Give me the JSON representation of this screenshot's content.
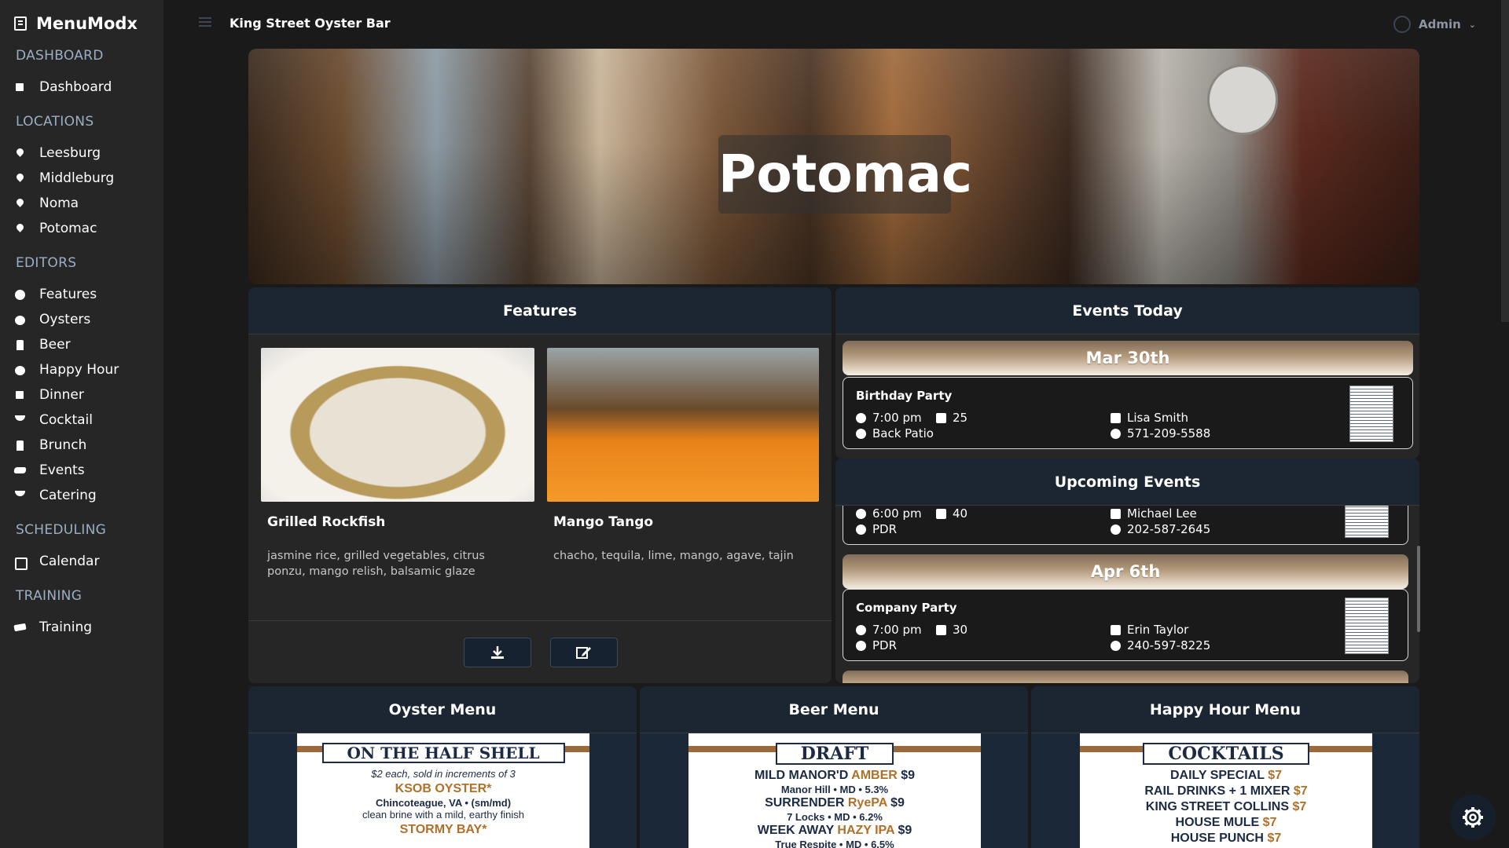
{
  "app": {
    "name": "MenuModx"
  },
  "sidebar": {
    "sections": [
      {
        "title": "DASHBOARD",
        "items": [
          {
            "label": "Dashboard",
            "icon": "dashboard-icon"
          }
        ]
      },
      {
        "title": "LOCATIONS",
        "items": [
          {
            "label": "Leesburg",
            "icon": "map-pin-icon"
          },
          {
            "label": "Middleburg",
            "icon": "map-pin-icon"
          },
          {
            "label": "Noma",
            "icon": "map-pin-icon"
          },
          {
            "label": "Potomac",
            "icon": "map-pin-icon"
          }
        ]
      },
      {
        "title": "EDITORS",
        "items": [
          {
            "label": "Features",
            "icon": "plus-circle-icon"
          },
          {
            "label": "Oysters",
            "icon": "oyster-icon"
          },
          {
            "label": "Beer",
            "icon": "beer-mug-icon"
          },
          {
            "label": "Happy Hour",
            "icon": "smile-icon"
          },
          {
            "label": "Dinner",
            "icon": "dinner-icon"
          },
          {
            "label": "Cocktail",
            "icon": "cocktail-icon"
          },
          {
            "label": "Brunch",
            "icon": "brunch-icon"
          },
          {
            "label": "Events",
            "icon": "party-icon"
          },
          {
            "label": "Catering",
            "icon": "catering-icon"
          }
        ]
      },
      {
        "title": "SCHEDULING",
        "items": [
          {
            "label": "Calendar",
            "icon": "calendar-icon"
          }
        ]
      },
      {
        "title": "TRAINING",
        "items": [
          {
            "label": "Training",
            "icon": "graduation-cap-icon"
          }
        ]
      }
    ]
  },
  "topbar": {
    "context_title": "King Street Oyster Bar",
    "user_label": "Admin"
  },
  "hero": {
    "title": "Potomac"
  },
  "features": {
    "title": "Features",
    "items": [
      {
        "name": "Grilled Rockfish",
        "description": "jasmine rice, grilled vegetables, citrus ponzu, mango relish, balsamic glaze"
      },
      {
        "name": "Mango Tango",
        "description": "chacho, tequila, lime, mango, agave, tajin"
      }
    ]
  },
  "events_today": {
    "title": "Events Today",
    "date": "Mar 30th",
    "events": [
      {
        "name": "Birthday Party",
        "time": "7:00 pm",
        "guests": "25",
        "location": "Back Patio",
        "contact": "Lisa Smith",
        "phone": "571-209-5588"
      }
    ]
  },
  "upcoming": {
    "title": "Upcoming Events",
    "partial_event": {
      "time": "6:00 pm",
      "guests": "40",
      "location": "PDR",
      "contact": "Michael Lee",
      "phone": "202-587-2645"
    },
    "date": "Apr 6th",
    "events": [
      {
        "name": "Company Party",
        "time": "7:00 pm",
        "guests": "30",
        "location": "PDR",
        "contact": "Erin Taylor",
        "phone": "240-597-8225"
      }
    ]
  },
  "menus": {
    "oyster": {
      "title": "Oyster Menu",
      "head": "ON THE HALF SHELL",
      "line1": "$2 each, sold in increments of 3",
      "line2": "KSOB OYSTER*",
      "line3": "Chincoteague, VA • (sm/md)",
      "line4": "clean brine with a mild, earthy finish",
      "line5": "STORMY BAY*"
    },
    "beer": {
      "title": "Beer Menu",
      "head": "DRAFT",
      "lines": [
        {
          "a": "MILD MANOR'D ",
          "b": "AMBER",
          "c": " $9"
        },
        {
          "sub": "Manor Hill • MD • 5.3%"
        },
        {
          "a": "SURRENDER ",
          "b": "RyePA",
          "c": " $9"
        },
        {
          "sub": "7 Locks • MD • 6.2%"
        },
        {
          "a": "WEEK AWAY ",
          "b": "HAZY IPA",
          "c": " $9"
        },
        {
          "sub": "True Respite • MD • 6.5%"
        }
      ]
    },
    "happy": {
      "title": "Happy Hour Menu",
      "head": "COCKTAILS",
      "lines": [
        {
          "a": "DAILY SPECIAL ",
          "b": "$7"
        },
        {
          "a": "RAIL DRINKS + 1 MIXER ",
          "b": "$7"
        },
        {
          "a": "KING STREET COLLINS ",
          "b": "$7"
        },
        {
          "a": "HOUSE MULE ",
          "b": "$7"
        },
        {
          "a": "HOUSE PUNCH ",
          "b": "$7"
        }
      ]
    }
  },
  "colors": {
    "sidebar_bg": "#262626",
    "panel_header": "#1c2632",
    "section_label": "#9aaec4",
    "accent_gold": "#b0702a",
    "date_band": "#b49a7c"
  }
}
